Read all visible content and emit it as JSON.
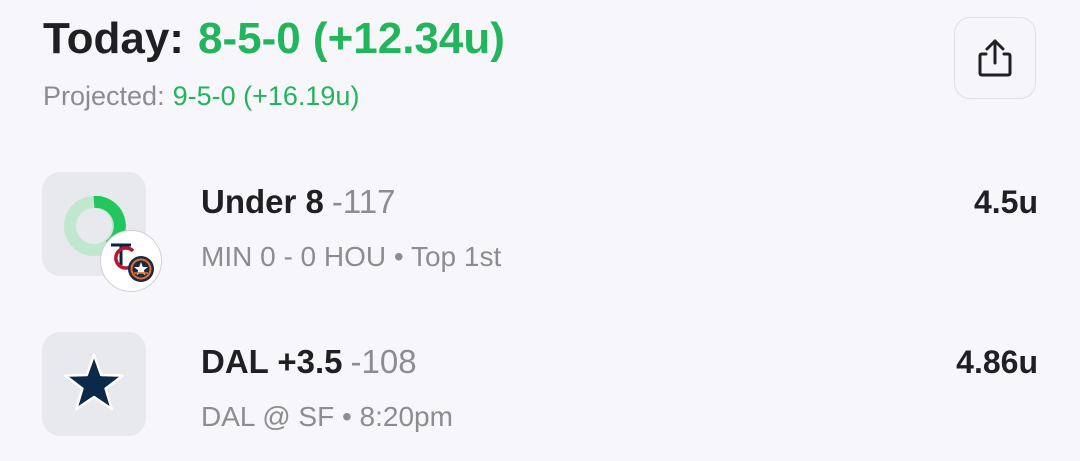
{
  "header": {
    "today_label": "Today:",
    "today_record": "8-5-0 (+12.34u)",
    "projected_label": "Projected:",
    "projected_record": "9-5-0 (+16.19u)"
  },
  "share_button": {
    "icon": "share-icon"
  },
  "bets": [
    {
      "title": "Under 8",
      "odds": "-117",
      "subtitle": "MIN 0 - 0 HOU • Top 1st",
      "units": "4.5u",
      "icon": "live-progress-ring-icon",
      "badge_icon": "twins-astros-logo-icon"
    },
    {
      "title": "DAL +3.5",
      "odds": "-108",
      "subtitle": "DAL @ SF • 8:20pm",
      "units": "4.86u",
      "icon": "cowboys-star-icon"
    }
  ],
  "colors": {
    "accent_green": "#22b55c",
    "text_dark": "#1f1f24",
    "text_gray": "#8b8d93",
    "cowboys_navy": "#0b2a4a"
  }
}
